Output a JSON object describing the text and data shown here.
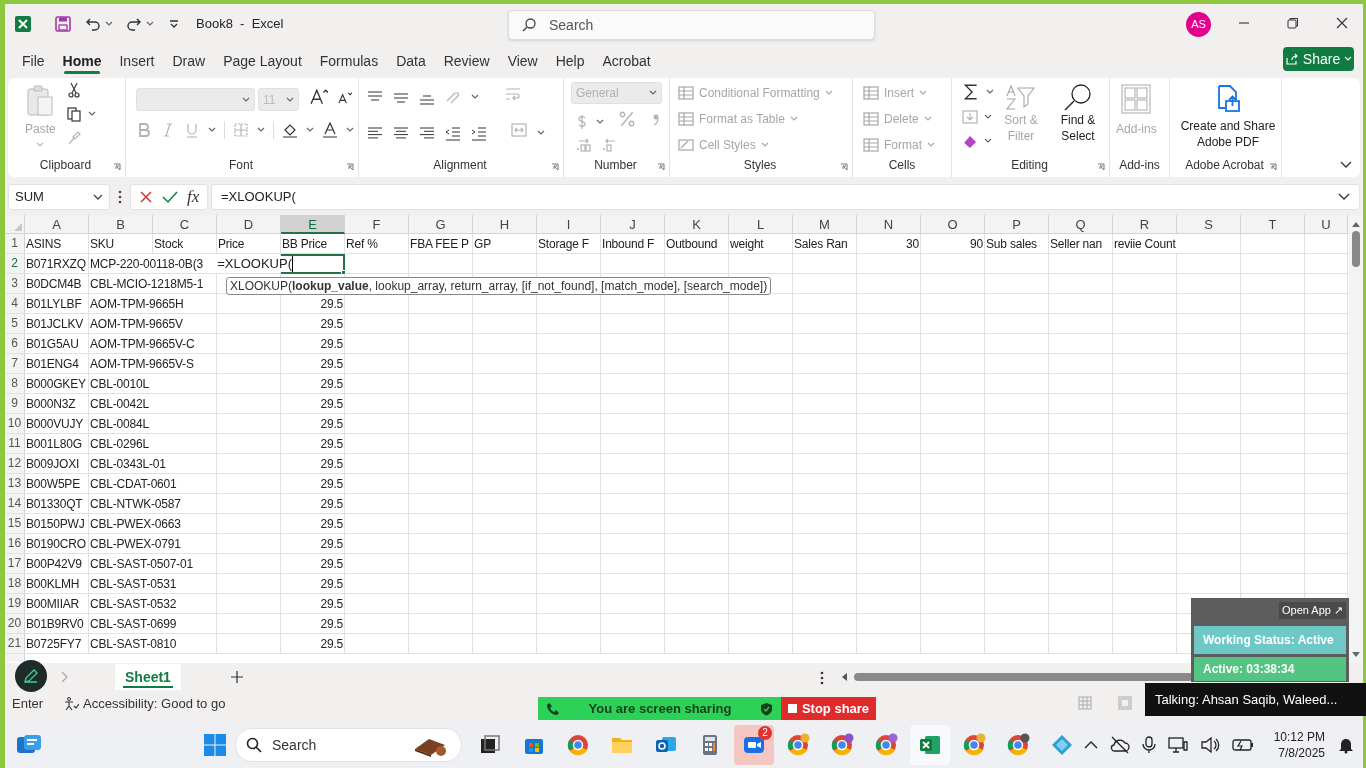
{
  "title_bar": {
    "document_title": "Book8  -  Excel",
    "search_placeholder": "Search",
    "avatar_initials": "AS"
  },
  "menu_tabs": [
    {
      "label": "File",
      "selected": false
    },
    {
      "label": "Home",
      "selected": true
    },
    {
      "label": "Insert",
      "selected": false
    },
    {
      "label": "Draw",
      "selected": false
    },
    {
      "label": "Page Layout",
      "selected": false
    },
    {
      "label": "Formulas",
      "selected": false
    },
    {
      "label": "Data",
      "selected": false
    },
    {
      "label": "Review",
      "selected": false
    },
    {
      "label": "View",
      "selected": false
    },
    {
      "label": "Help",
      "selected": false
    },
    {
      "label": "Acrobat",
      "selected": false
    }
  ],
  "share_button": "Share",
  "ribbon": {
    "groups": [
      {
        "label": "Clipboard",
        "buttons": [
          {
            "label": "Paste",
            "disabled": true
          },
          {
            "disabled": false
          },
          {
            "disabled": false
          },
          {
            "disabled": true
          }
        ]
      },
      {
        "label": "Font",
        "font_size": "11",
        "buttons": [
          {
            "disabled": true
          },
          {
            "disabled": true
          },
          {
            "disabled": false
          },
          {
            "disabled": false
          },
          {
            "disabled": true
          },
          {
            "disabled": true
          },
          {
            "disabled": true
          },
          {
            "disabled": true
          },
          {
            "disabled": false
          },
          {
            "disabled": false
          }
        ]
      },
      {
        "label": "Alignment",
        "buttons": [
          {
            "disabled": false
          },
          {
            "disabled": false
          },
          {
            "disabled": false
          },
          {
            "disabled": true
          },
          {
            "disabled": true
          },
          {
            "disabled": false
          },
          {
            "disabled": false
          },
          {
            "disabled": false
          },
          {
            "disabled": false
          },
          {
            "disabled": false
          },
          {
            "disabled": true
          }
        ]
      },
      {
        "label": "Number",
        "format": "General",
        "buttons": [
          {
            "disabled": true
          },
          {
            "disabled": true
          },
          {
            "disabled": true
          },
          {
            "disabled": true
          },
          {
            "disabled": true
          },
          {
            "disabled": true
          }
        ]
      },
      {
        "label": "Styles",
        "buttons": [
          {
            "label": "Conditional Formatting",
            "disabled": true
          },
          {
            "label": "Format as Table",
            "disabled": true
          },
          {
            "label": "Cell Styles",
            "disabled": true
          }
        ]
      },
      {
        "label": "Cells",
        "buttons": [
          {
            "label": "Insert",
            "disabled": true
          },
          {
            "label": "Delete",
            "disabled": true
          },
          {
            "label": "Format",
            "disabled": true
          }
        ]
      },
      {
        "label": "Editing",
        "buttons": [
          {
            "disabled": false
          },
          {
            "disabled": true
          },
          {
            "disabled": false
          },
          {
            "label": "Sort & Filter",
            "disabled": true
          },
          {
            "label": "Find & Select",
            "disabled": false
          }
        ]
      },
      {
        "label": "Add-ins",
        "buttons": [
          {
            "label": "Add-ins",
            "disabled": true
          }
        ]
      },
      {
        "label": "Adobe Acrobat",
        "buttons": [
          {
            "label": "Create and Share Adobe PDF",
            "disabled": false
          }
        ]
      }
    ]
  },
  "formula_bar": {
    "name_box": "SUM",
    "fx": "fx",
    "formula": "=XLOOKUP("
  },
  "sheet": {
    "columns": [
      {
        "label": "A",
        "selected": false
      },
      {
        "label": "B",
        "selected": false
      },
      {
        "label": "C",
        "selected": false
      },
      {
        "label": "D",
        "selected": false
      },
      {
        "label": "E",
        "selected": true
      },
      {
        "label": "F",
        "selected": false
      },
      {
        "label": "G",
        "selected": false
      },
      {
        "label": "H",
        "selected": false
      },
      {
        "label": "I",
        "selected": false
      },
      {
        "label": "J",
        "selected": false
      },
      {
        "label": "K",
        "selected": false
      },
      {
        "label": "L",
        "selected": false
      },
      {
        "label": "M",
        "selected": false
      },
      {
        "label": "N",
        "selected": false
      },
      {
        "label": "O",
        "selected": false
      },
      {
        "label": "P",
        "selected": false
      },
      {
        "label": "Q",
        "selected": false
      },
      {
        "label": "R",
        "selected": false
      },
      {
        "label": "S",
        "selected": false
      },
      {
        "label": "T",
        "selected": false
      },
      {
        "label": "U",
        "selected": false
      }
    ],
    "rows": [
      {
        "number": "1",
        "selected": false,
        "cells": {
          "A": "ASINS",
          "B": "SKU",
          "C": "Stock",
          "D": "Price",
          "E": "BB Price",
          "F": "Ref %",
          "G": "FBA FEE P",
          "H": "GP",
          "I": "Storage F",
          "J": "Inbound F",
          "K": "Outbound",
          "L": "weight",
          "M": "Sales Ran",
          "N": "30",
          "O": "90",
          "P": "Sub sales",
          "Q": "Seller nan",
          "R": "reviie Count"
        }
      },
      {
        "number": "2",
        "selected": true,
        "cells": {
          "A": "B071RXZQ",
          "B": "MCP-220-00118-0B(3"
        },
        "editing": {
          "E": "=XLOOKUP("
        }
      },
      {
        "number": "3",
        "selected": false,
        "cells": {
          "A": "B0DCM4B",
          "B": "CBL-MCIO-1218M5-1"
        }
      },
      {
        "number": "4",
        "selected": false,
        "cells": {
          "A": "B01LYLBF",
          "B": "AOM-TPM-9665H",
          "E": "29.5"
        }
      },
      {
        "number": "5",
        "selected": false,
        "cells": {
          "A": "B01JCLKV",
          "B": "AOM-TPM-9665V",
          "E": "29.5"
        }
      },
      {
        "number": "6",
        "selected": false,
        "cells": {
          "A": "B01G5AU",
          "B": "AOM-TPM-9665V-C",
          "E": "29.5"
        }
      },
      {
        "number": "7",
        "selected": false,
        "cells": {
          "A": "B01ENG4",
          "B": "AOM-TPM-9665V-S",
          "E": "29.5"
        }
      },
      {
        "number": "8",
        "selected": false,
        "cells": {
          "A": "B000GKEY",
          "B": "CBL-0010L",
          "E": "29.5"
        }
      },
      {
        "number": "9",
        "selected": false,
        "cells": {
          "A": "B000N3Z",
          "B": "CBL-0042L",
          "E": "29.5"
        }
      },
      {
        "number": "10",
        "selected": false,
        "cells": {
          "A": "B000VUJY",
          "B": "CBL-0084L",
          "E": "29.5"
        }
      },
      {
        "number": "11",
        "selected": false,
        "cells": {
          "A": "B001L80G",
          "B": "CBL-0296L",
          "E": "29.5"
        }
      },
      {
        "number": "12",
        "selected": false,
        "cells": {
          "A": "B009JOXI",
          "B": "CBL-0343L-01",
          "E": "29.5"
        }
      },
      {
        "number": "13",
        "selected": false,
        "cells": {
          "A": "B00W5PE",
          "B": "CBL-CDAT-0601",
          "E": "29.5"
        }
      },
      {
        "number": "14",
        "selected": false,
        "cells": {
          "A": "B01330QT",
          "B": "CBL-NTWK-0587",
          "E": "29.5"
        }
      },
      {
        "number": "15",
        "selected": false,
        "cells": {
          "A": "B0150PWJ",
          "B": "CBL-PWEX-0663",
          "E": "29.5"
        }
      },
      {
        "number": "16",
        "selected": false,
        "cells": {
          "A": "B0190CRO",
          "B": "CBL-PWEX-0791",
          "E": "29.5"
        }
      },
      {
        "number": "17",
        "selected": false,
        "cells": {
          "A": "B00P42V9",
          "B": "CBL-SAST-0507-01",
          "E": "29.5"
        }
      },
      {
        "number": "18",
        "selected": false,
        "cells": {
          "A": "B00KLMH",
          "B": "CBL-SAST-0531",
          "E": "29.5"
        }
      },
      {
        "number": "19",
        "selected": false,
        "cells": {
          "A": "B00MIIAR",
          "B": "CBL-SAST-0532",
          "E": "29.5"
        }
      },
      {
        "number": "20",
        "selected": false,
        "cells": {
          "A": "B01B9RV0",
          "B": "CBL-SAST-0699",
          "E": "29.5"
        }
      },
      {
        "number": "21",
        "selected": false,
        "cells": {
          "A": "B0725FY7",
          "B": "CBL-SAST-0810",
          "E": "29.5"
        }
      }
    ],
    "formula_tooltip": "XLOOKUP(**lookup_value**, lookup_array, return_array, [if_not_found], [match_mode], [search_mode])"
  },
  "sheet_tabs": [
    {
      "label": "Sheet1",
      "selected": true
    }
  ],
  "status_bar": {
    "mode": "Enter",
    "accessibility": "Accessibility: Good to go"
  },
  "screen_share": {
    "message": "You are screen sharing",
    "stop": "Stop share"
  },
  "tracker": {
    "open_app": "Open App ↗",
    "status": "Working Status: Active",
    "active": "Active: 03:38:34"
  },
  "talking": "Talking: Ahsan Saqib, Waleed...",
  "taskbar": {
    "search": "Search",
    "badge": "2",
    "time": "10:12 PM",
    "date": "7/8/2025"
  }
}
